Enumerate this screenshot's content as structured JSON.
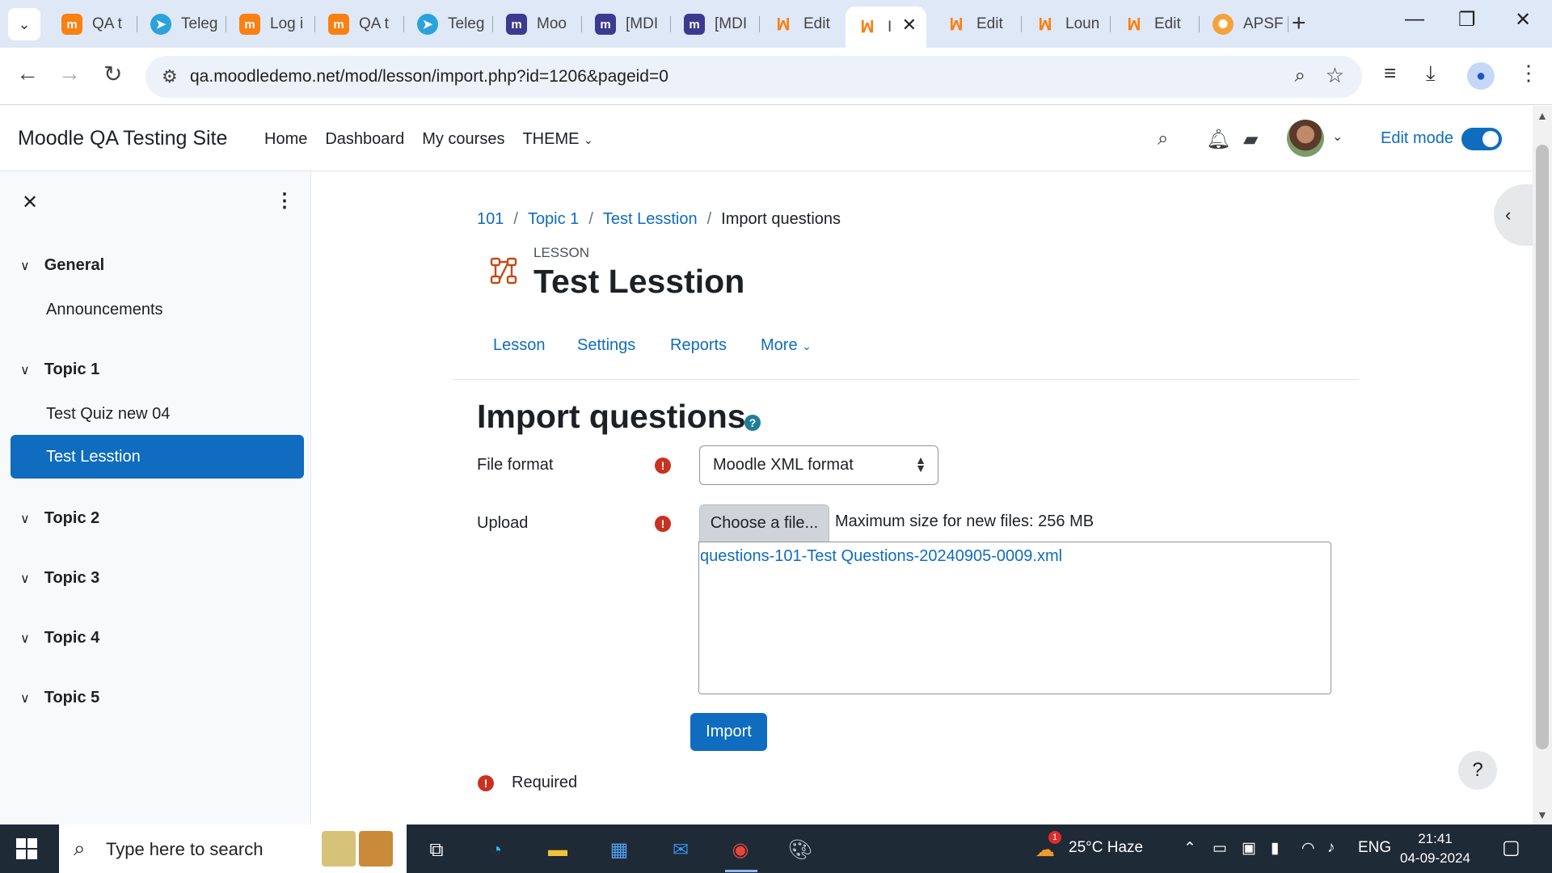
{
  "browser": {
    "tabs": [
      {
        "label": "QA t",
        "favicon": "moodle-orange-icon"
      },
      {
        "label": "Teleg",
        "favicon": "telegram-icon"
      },
      {
        "label": "Log i",
        "favicon": "moodle-orange-icon"
      },
      {
        "label": "QA t",
        "favicon": "moodle-orange-icon"
      },
      {
        "label": "Teleg",
        "favicon": "telegram-icon"
      },
      {
        "label": "Moo",
        "favicon": "moodle-dark-icon"
      },
      {
        "label": "[MDI",
        "favicon": "moodle-dark-icon"
      },
      {
        "label": "[MDI",
        "favicon": "moodle-dark-icon"
      },
      {
        "label": "Edit",
        "favicon": "moodle-line-icon"
      },
      {
        "label": "I",
        "favicon": "moodle-line-icon",
        "active": true
      },
      {
        "label": "Edit",
        "favicon": "moodle-line-icon"
      },
      {
        "label": "Loun",
        "favicon": "moodle-line-icon"
      },
      {
        "label": "Edit",
        "favicon": "moodle-line-icon"
      },
      {
        "label": "APSF",
        "favicon": "apsf-icon"
      }
    ],
    "url": "qa.moodledemo.net/mod/lesson/import.php?id=1206&pageid=0"
  },
  "navbar": {
    "site_name": "Moodle QA Testing Site",
    "links": [
      "Home",
      "Dashboard",
      "My courses",
      "THEME"
    ],
    "edit_mode_label": "Edit mode",
    "edit_mode_on": true
  },
  "course_index": {
    "sections": [
      {
        "title": "General",
        "items": [
          "Announcements"
        ]
      },
      {
        "title": "Topic 1",
        "items": [
          "Test Quiz new 04",
          "Test Lesstion"
        ]
      },
      {
        "title": "Topic 2",
        "items": []
      },
      {
        "title": "Topic 3",
        "items": []
      },
      {
        "title": "Topic 4",
        "items": []
      },
      {
        "title": "Topic 5",
        "items": []
      }
    ],
    "active_item": "Test Lesstion"
  },
  "breadcrumb": [
    "101",
    "Topic 1",
    "Test Lesstion",
    "Import questions"
  ],
  "activity": {
    "kind": "LESSON",
    "title": "Test Lesstion"
  },
  "secondary_nav": [
    "Lesson",
    "Settings",
    "Reports",
    "More"
  ],
  "form": {
    "heading": "Import questions",
    "file_format_label": "File format",
    "file_format_value": "Moodle XML format",
    "upload_label": "Upload",
    "choose_file_label": "Choose a file...",
    "max_size_text": "Maximum size for new files: 256 MB",
    "uploaded_file": "questions-101-Test Questions-20240905-0009.xml",
    "import_label": "Import",
    "required_note": "Required",
    "help_fab_label": "?"
  },
  "taskbar": {
    "search_placeholder": "Type here to search",
    "weather": "25°C  Haze",
    "weather_badge": "1",
    "language": "ENG",
    "time": "21:41",
    "date": "04-09-2024"
  },
  "colors": {
    "brand_blue": "#0f6cbf",
    "required_red": "#ca3120",
    "drawer_bg": "#f8f9fa",
    "taskbar_bg": "#1f2a37"
  }
}
